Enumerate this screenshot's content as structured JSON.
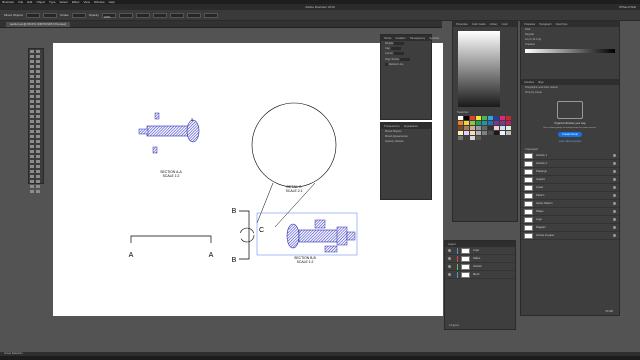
{
  "menubar": [
    "Illustrator",
    "File",
    "Edit",
    "Object",
    "Type",
    "Select",
    "Effect",
    "View",
    "Window",
    "Help"
  ],
  "window_title": "Adobe Illustrator 2019",
  "workspace": "Offhand Wiki",
  "control": {
    "object": "Mixed Objects",
    "stroke_label": "Stroke",
    "opacity_label": "Opacity",
    "opacity": "100%"
  },
  "doc_tab": "section.ai @ 66.6% (CMYK/GPU Preview)",
  "drawing": {
    "section_aa": "SECTION A-A",
    "section_aa_scale": "SCALE 1:2",
    "detail_c": "DETAIL C",
    "detail_c_scale": "SCALE 2:1",
    "section_bb": "SECTION B-B",
    "section_bb_scale": "SCALE 1:2",
    "label_a_left": "A",
    "label_a_right": "A",
    "label_b_top": "B",
    "label_b_bottom": "B",
    "label_c": "C",
    "label_5": "5"
  },
  "stroke_panel": {
    "tabs": [
      "Stroke",
      "Gradient",
      "Transparency",
      "Symbols"
    ],
    "rows": [
      "Weight",
      "Cap",
      "Corner",
      "Align Stroke",
      "Dashed Line"
    ]
  },
  "appearance_panel": {
    "tabs": [
      "Transparency",
      "Appearance"
    ],
    "rows": [
      "Mixed Objects",
      "Mixed Appearances",
      "Opacity: Default"
    ]
  },
  "color_panel": {
    "tabs": [
      "Properties",
      "Color Guide",
      "Library",
      "Color"
    ],
    "swatches_label": "Swatches"
  },
  "layers_panel": {
    "tab": "Layers",
    "layers": [
      {
        "name": "Linjer",
        "color": "#4f8ff7"
      },
      {
        "name": "Skåne",
        "color": "#e3493b"
      },
      {
        "name": "Artwork",
        "color": "#58c556"
      },
      {
        "name": "Mesh",
        "color": "#4f8ff7"
      }
    ],
    "footer": "4 Layers"
  },
  "character_panel": {
    "tabs": [
      "Character",
      "Paragraph",
      "OpenType"
    ],
    "font": "Arial",
    "style": "Regular",
    "size": "12 pt",
    "leading": "(14.4 pt)",
    "gradient_label": "Gradient"
  },
  "libraries_panel": {
    "tabs": [
      "Libraries",
      "Align"
    ],
    "library": "Infographic and other assets",
    "view_by": "View by Group",
    "empty_title": "Organize libraries your way",
    "empty_text": "Use custom groups to arrange items for easier access.",
    "create_button": "Create Group",
    "learn_link": "Learn about groups",
    "group_label": "Ungrouped",
    "items": [
      "Artwork 1",
      "Artwork 2",
      "Drawings",
      "Graphic",
      "Linear",
      "Pattern",
      "Vector Pattern",
      "Shape",
      "Logo",
      "Diagram",
      "Arrows of paper"
    ],
    "footer": "95 MB"
  },
  "status": "Group Selection"
}
